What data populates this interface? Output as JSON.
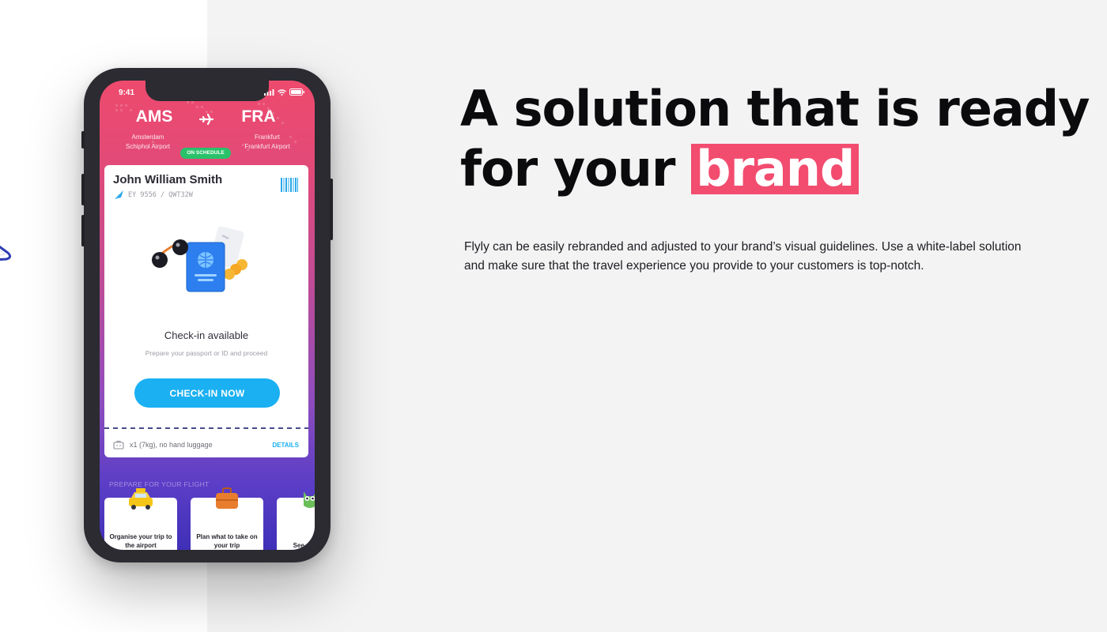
{
  "phone": {
    "status_time": "9:41",
    "route": {
      "from_code": "AMS",
      "from_name_line1": "Amsterdam",
      "from_name_line2": "Schiphol Airport",
      "to_code": "FRA",
      "to_name_line1": "Frankfurt",
      "to_name_line2": "Frankfurt Airport",
      "status_badge": "ON SCHEDULE"
    },
    "card": {
      "passenger_name": "John William Smith",
      "flight_code": "EY 9556 / QWT32W",
      "checkin_title": "Check-in available",
      "checkin_subtitle": "Prepare your passport or ID and proceed",
      "checkin_button": "CHECK-IN NOW",
      "luggage_text": "x1 (7kg), no hand luggage",
      "details_link": "DETAILS"
    },
    "prepare_section": {
      "label": "PREPARE FOR YOUR FLIGHT",
      "tiles": [
        {
          "label": "Organise your trip to the airport",
          "icon": "taxi-icon"
        },
        {
          "label": "Plan what to take on your trip",
          "icon": "suitcase-icon"
        },
        {
          "label": "See what has",
          "icon": "owl-icon"
        }
      ]
    }
  },
  "hero": {
    "headline_line1": "A solution that is ready",
    "headline_line2_prefix": "for your",
    "headline_highlight": "brand",
    "description": "Flyly can be easily rebranded and adjusted to your brand’s visual guidelines. Use a white-label solution and make sure that the travel experience you provide to your customers is top-notch."
  },
  "colors": {
    "brand_pink": "#f24c6f",
    "gradient_top": "#ee4a6d",
    "gradient_bottom": "#3f2fb7",
    "accent_blue": "#1ab0f2",
    "status_green": "#29c26a",
    "page_bg": "#f3f3f4"
  }
}
